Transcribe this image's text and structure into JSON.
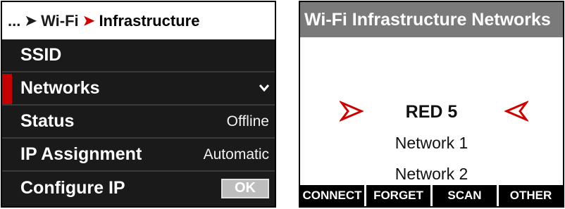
{
  "left_panel": {
    "breadcrumb": {
      "root": "...",
      "parent": "Wi-Fi",
      "current": "Infrastructure",
      "separator": "➤"
    },
    "menu": [
      {
        "label": "SSID",
        "value": ""
      },
      {
        "label": "Networks",
        "value": ""
      },
      {
        "label": "Status",
        "value": "Offline"
      },
      {
        "label": "IP Assignment",
        "value": "Automatic"
      },
      {
        "label": "Configure IP",
        "value": ""
      }
    ],
    "ok_label": "OK",
    "selected_index": 1,
    "chevron_icon": "chevron-down-icon",
    "colors": {
      "background": "#1a1a1a",
      "accent": "#c40000",
      "divider": "#3a3a3a"
    }
  },
  "right_panel": {
    "title": "Wi-Fi Infrastructure Networks",
    "networks": [
      "RED 5",
      "Network 1",
      "Network 2"
    ],
    "selected_index": 0,
    "softkeys": [
      "CONNECT",
      "FORGET",
      "SCAN",
      "OTHER"
    ],
    "selection_icons": [
      "arrow-right-icon",
      "arrow-left-icon"
    ],
    "colors": {
      "title_bar": "#7a7a7a",
      "arrow": "#d10000",
      "softkey": "#000000"
    }
  }
}
